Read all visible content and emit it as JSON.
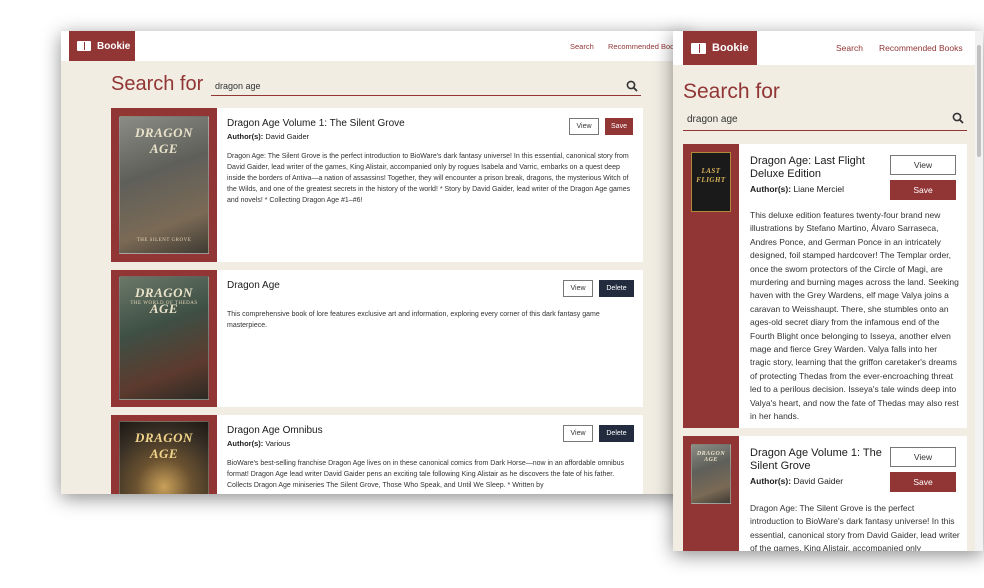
{
  "app": {
    "brand": "Bookie",
    "nav": {
      "search": "Search",
      "recommended": "Recommended Books"
    }
  },
  "search": {
    "heading": "Search for",
    "query": "dragon age",
    "placeholder": ""
  },
  "buttons": {
    "view": "View",
    "save": "Save",
    "delete": "Delete"
  },
  "authors_prefix": "Author(s):",
  "back_results": [
    {
      "title": "Dragon Age Volume 1: The Silent Grove",
      "authors": "David Gaider",
      "description": "Dragon Age: The Silent Grove is the perfect introduction to BioWare's dark fantasy universe! In this essential, canonical story from David Gaider, lead writer of the games, King Alistair, accompanied only by rogues Isabela and Varric, embarks on a quest deep inside the borders of Antiva—a nation of assassins! Together, they will encounter a prison break, dragons, the mysterious Witch of the Wilds, and one of the greatest secrets in the history of the world! * Story by David Gaider, lead writer of the Dragon Age games and novels! * Collecting Dragon Age #1–#6!",
      "cover": {
        "title": "DRAGON AGE",
        "subtitle": "THE SILENT GROVE",
        "color": "#6f6f6c"
      },
      "action": "Save"
    },
    {
      "title": "Dragon Age",
      "authors": "",
      "description": "This comprehensive book of lore features exclusive art and information, exploring every corner of this dark fantasy game masterpiece.",
      "cover": {
        "title": "DRAGON AGE",
        "subtitle": "THE WORLD OF THEDAS",
        "color": "#3e4f44"
      },
      "action": "Delete"
    },
    {
      "title": "Dragon Age Omnibus",
      "authors": "Various",
      "description": "BioWare's best-selling franchise Dragon Age lives on in these canonical comics from Dark Horse—now in an affordable omnibus format! Dragon Age lead writer David Gaider pens an exciting tale following King Alistair as he discovers the fate of his father. Collects Dragon Age miniseries The Silent Grove, Those Who Speak, and Until We Sleep. * Written by",
      "cover": {
        "title": "DRAGON AGE",
        "subtitle": "",
        "color": "#3a3126"
      },
      "action": "Delete"
    }
  ],
  "front_results": [
    {
      "title": "Dragon Age: Last Flight Deluxe Edition",
      "authors": "Liane Merciel",
      "description": "This deluxe edition features twenty-four brand new illustrations by Stefano Martino, Álvaro Sarraseca, Andres Ponce, and German Ponce in an intricately designed, foil stamped hardcover! The Templar order, once the sworn protectors of the Circle of Magi, are murdering and burning mages across the land. Seeking haven with the Grey Wardens, elf mage Valya joins a caravan to Weisshaupt. There, she stumbles onto an ages-old secret diary from the infamous end of the Fourth Blight once belonging to Isseya, another elven mage and fierce Grey Warden. Valya falls into her tragic story, learning that the griffon caretaker's dreams of protecting Thedas from the ever-encroaching threat led to a perilous decision. Isseya's tale winds deep into Valya's heart, and now the fate of Thedas may also rest in her hands.",
      "cover": {
        "title": "LAST FLIGHT",
        "color": "#1a1a1a"
      },
      "action": "Save"
    },
    {
      "title": "Dragon Age Volume 1: The Silent Grove",
      "authors": "David Gaider",
      "description": "Dragon Age: The Silent Grove is the perfect introduction to BioWare's dark fantasy universe! In this essential, canonical story from David Gaider, lead writer of the games, King Alistair, accompanied only",
      "cover": {
        "title": "DRAGON AGE",
        "color": "#6f6f6c"
      },
      "action": "Save"
    }
  ],
  "colors": {
    "accent": "#923535",
    "background": "#f1ede3",
    "dark_button": "#232b3f"
  }
}
